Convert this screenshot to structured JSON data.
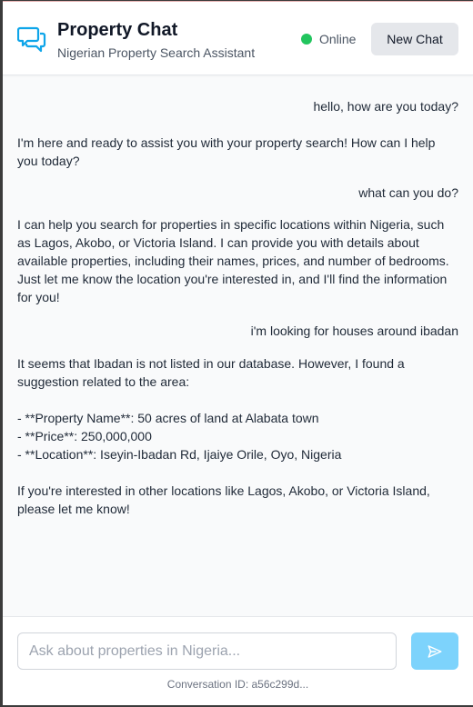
{
  "header": {
    "title": "Property Chat",
    "subtitle": "Nigerian Property Search Assistant",
    "status": "Online",
    "new_chat_label": "New Chat",
    "icon": "chat-bubbles-icon"
  },
  "colors": {
    "accent": "#0ea5e9",
    "online": "#22c55e",
    "send_button": "#7dd3fc"
  },
  "messages": [
    {
      "role": "user",
      "text": "hello, how are you today?"
    },
    {
      "role": "assistant",
      "text": "I'm here and ready to assist you with your property search! How can I help you today?"
    },
    {
      "role": "user",
      "text": "what can you do?"
    },
    {
      "role": "assistant",
      "text": "I can help you search for properties in specific locations within Nigeria, such as Lagos, Akobo, or Victoria Island. I can provide you with details about available properties, including their names, prices, and number of bedrooms. Just let me know the location you're interested in, and I'll find the information for you!"
    },
    {
      "role": "user",
      "text": "i'm looking for houses around ibadan"
    },
    {
      "role": "assistant",
      "lines": [
        "It seems that Ibadan is not listed in our database. However, I found a suggestion related to the area:",
        "- **Property Name**: 50 acres of land at Alabata town",
        "- **Price**: 250,000,000",
        "- **Location**: Iseyin-Ibadan Rd, Ijaiye Orile, Oyo, Nigeria",
        "If you're interested in other locations like Lagos, Akobo, or Victoria Island, please let me know!"
      ]
    }
  ],
  "composer": {
    "placeholder": "Ask about properties in Nigeria...",
    "value": "",
    "send_icon": "send-icon"
  },
  "footer": {
    "conversation_id": "Conversation ID: a56c299d..."
  }
}
